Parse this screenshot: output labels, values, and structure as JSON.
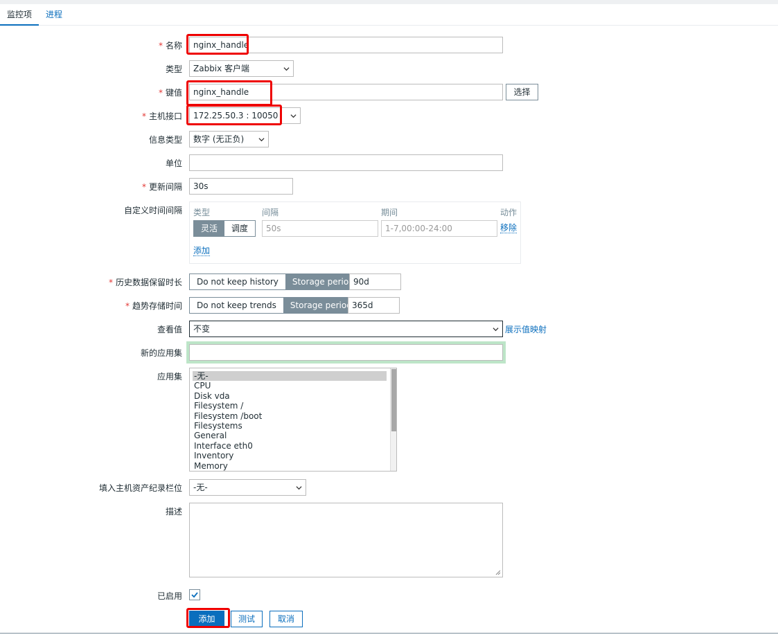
{
  "tabs": [
    {
      "label": "监控项"
    },
    {
      "label": "进程"
    }
  ],
  "form": {
    "name": {
      "label": "名称",
      "value": "nginx_handle"
    },
    "type": {
      "label": "类型",
      "value": "Zabbix 客户端"
    },
    "key": {
      "label": "键值",
      "value": "nginx_handle",
      "select_button": "选择"
    },
    "interface": {
      "label": "主机接口",
      "value": "172.25.50.3 : 10050"
    },
    "info_type": {
      "label": "信息类型",
      "value": "数字 (无正负)"
    },
    "unit": {
      "label": "单位",
      "value": ""
    },
    "update_interval": {
      "label": "更新间隔",
      "value": "30s"
    },
    "custom_intervals": {
      "label": "自定义时间间隔",
      "headers": {
        "type": "类型",
        "interval": "间隔",
        "period": "期间",
        "action": "动作"
      },
      "row": {
        "flexible": "灵活",
        "scheduling": "调度",
        "interval_placeholder": "50s",
        "period_placeholder": "1-7,00:00-24:00",
        "remove": "移除"
      },
      "add": "添加"
    },
    "history": {
      "label": "历史数据保留时长",
      "option_off": "Do not keep history",
      "option_on": "Storage period",
      "value": "90d"
    },
    "trends": {
      "label": "趋势存储时间",
      "option_off": "Do not keep trends",
      "option_on": "Storage period",
      "value": "365d"
    },
    "show_value": {
      "label": "查看值",
      "value": "不变",
      "link": "展示值映射"
    },
    "new_application": {
      "label": "新的应用集",
      "value": ""
    },
    "applications": {
      "label": "应用集",
      "options": [
        "-无-",
        "CPU",
        "Disk vda",
        "Filesystem /",
        "Filesystem /boot",
        "Filesystems",
        "General",
        "Interface eth0",
        "Inventory",
        "Memory"
      ],
      "selected": "-无-"
    },
    "inventory": {
      "label": "填入主机资产纪录栏位",
      "value": "-无-"
    },
    "description": {
      "label": "描述",
      "value": ""
    },
    "enabled": {
      "label": "已启用",
      "checked": true
    }
  },
  "buttons": {
    "add": "添加",
    "test": "测试",
    "cancel": "取消"
  },
  "colors": {
    "accent": "#0a6ebd",
    "required": "#e33734",
    "highlight": "#e00000",
    "focus_glow": "#bde5c8"
  }
}
